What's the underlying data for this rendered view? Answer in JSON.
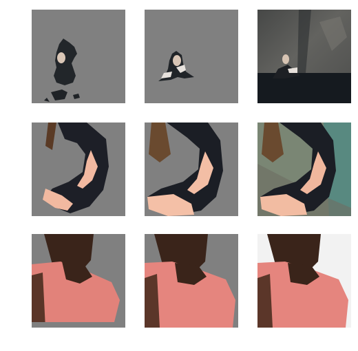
{
  "figure": {
    "rows": [
      {
        "subject": "woman-sitting-in-water",
        "tiles": [
          {
            "kind": "segmentation-coarse",
            "background": "#808080"
          },
          {
            "kind": "segmentation-refined",
            "background": "#808080"
          },
          {
            "kind": "original-photo",
            "background": "#3e3f3f"
          }
        ]
      },
      {
        "subject": "woman-black-dress-on-bench",
        "tiles": [
          {
            "kind": "segmentation-coarse",
            "background": "#808080"
          },
          {
            "kind": "segmentation-refined",
            "background": "#808080"
          },
          {
            "kind": "original-photo",
            "background": "#6f7a6c"
          }
        ]
      },
      {
        "subject": "man-pink-shirt",
        "tiles": [
          {
            "kind": "segmentation-coarse",
            "background": "#808080"
          },
          {
            "kind": "segmentation-refined",
            "background": "#808080"
          },
          {
            "kind": "original-photo",
            "background": "#f2f2f2"
          }
        ]
      }
    ]
  }
}
